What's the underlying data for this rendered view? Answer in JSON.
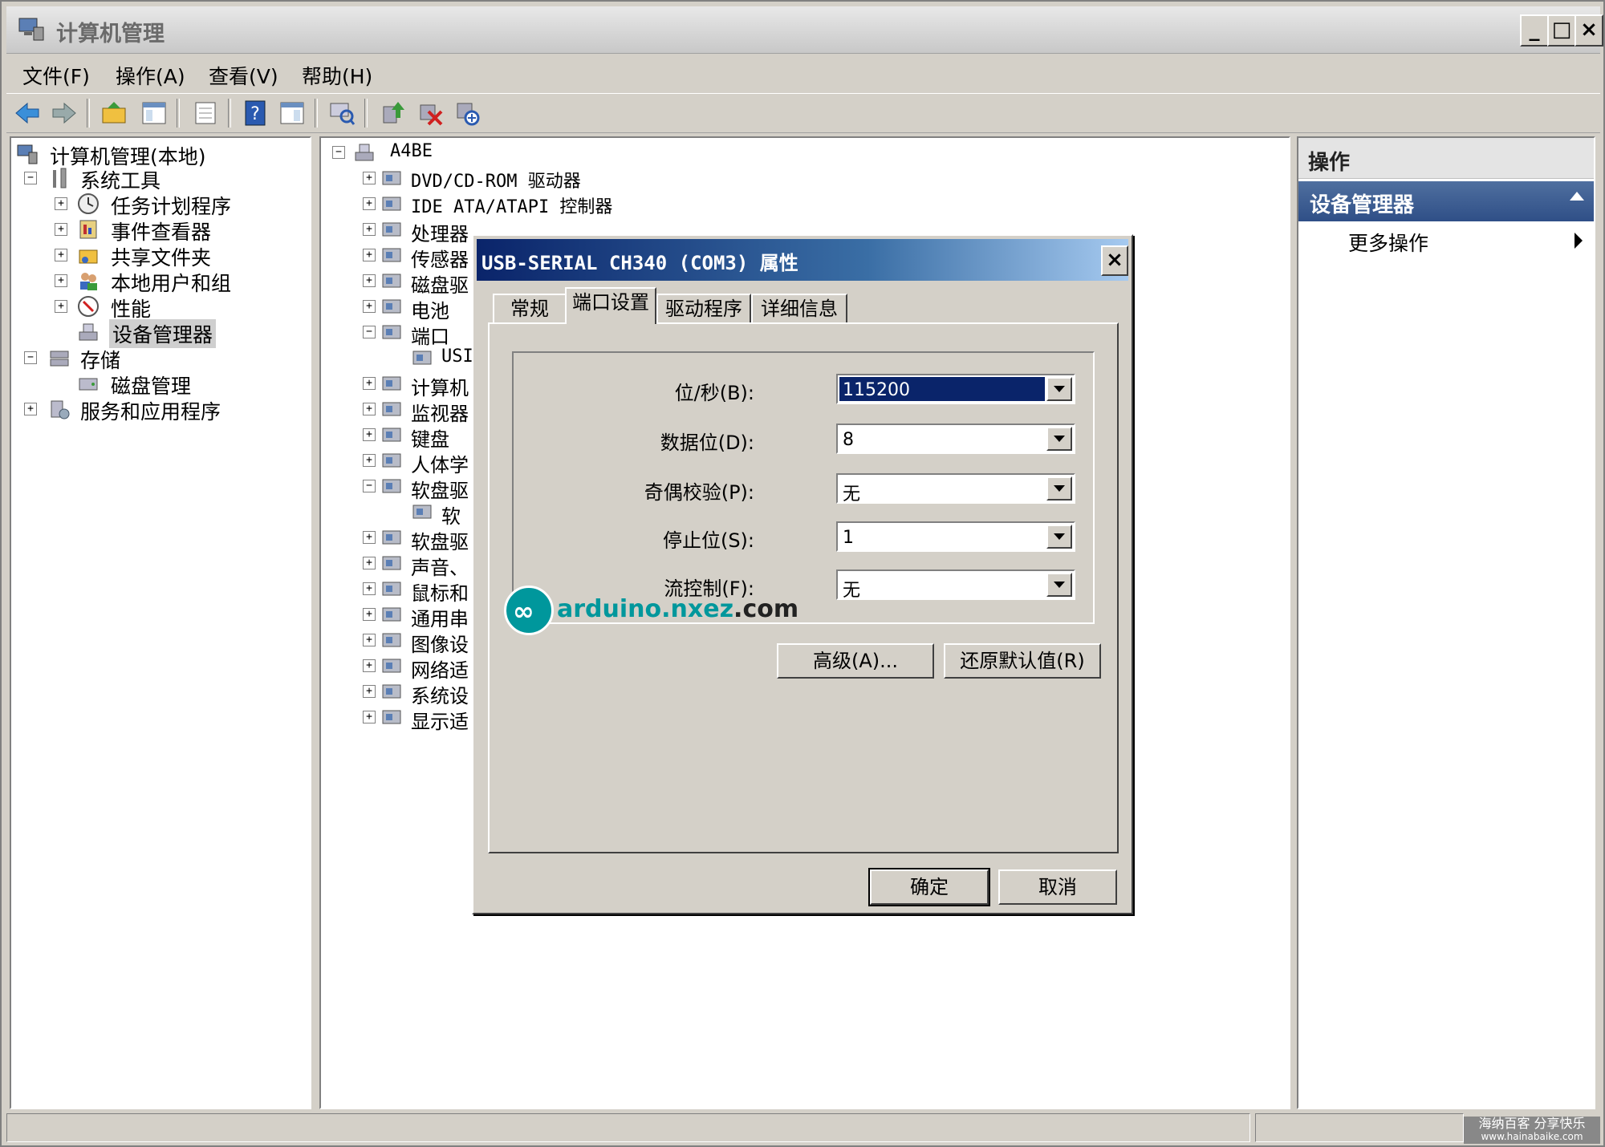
{
  "window": {
    "title": "计算机管理",
    "minimize": "_",
    "maximize": "□",
    "close": "×"
  },
  "menu": [
    "文件(F)",
    "操作(A)",
    "查看(V)",
    "帮助(H)"
  ],
  "left_tree": {
    "root": "计算机管理(本地)",
    "system_tools": "系统工具",
    "task_scheduler": "任务计划程序",
    "event_viewer": "事件查看器",
    "shared_folders": "共享文件夹",
    "local_users": "本地用户和组",
    "performance": "性能",
    "device_manager": "设备管理器",
    "storage": "存储",
    "disk_management": "磁盘管理",
    "services_apps": "服务和应用程序"
  },
  "device_tree": {
    "computer": "A4BE",
    "items": [
      "DVD/CD-ROM 驱动器",
      "IDE ATA/ATAPI 控制器",
      "处理器",
      "传感器",
      "磁盘驱",
      "电池",
      "端口",
      "USI",
      "计算机",
      "监视器",
      "键盘",
      "人体学",
      "软盘驱",
      "软",
      "软盘驱",
      "声音、",
      "鼠标和",
      "通用串",
      "图像设",
      "网络适",
      "系统设",
      "显示适"
    ]
  },
  "actions_pane": {
    "title": "操作",
    "section": "设备管理器",
    "more": "更多操作"
  },
  "dialog": {
    "title": "USB-SERIAL CH340 (COM3) 属性",
    "close": "×",
    "tabs": [
      "常规",
      "端口设置",
      "驱动程序",
      "详细信息"
    ],
    "active_tab": "端口设置",
    "fields": [
      {
        "label": "位/秒(B):",
        "value": "115200"
      },
      {
        "label": "数据位(D):",
        "value": "8"
      },
      {
        "label": "奇偶校验(P):",
        "value": "无"
      },
      {
        "label": "停止位(S):",
        "value": "1"
      },
      {
        "label": "流控制(F):",
        "value": "无"
      }
    ],
    "advanced": "高级(A)...",
    "restore": "还原默认值(R)",
    "ok": "确定",
    "cancel": "取消"
  },
  "watermark": {
    "logo_part1": "arduino",
    "logo_part2": ".nxez",
    "logo_part3": ".com",
    "corner_line1": "海纳百客 分享快乐",
    "corner_line2": "www.hainabaike.com"
  },
  "icons": [
    "computer-icon",
    "tools-icon",
    "clock-icon",
    "event-icon",
    "share-icon",
    "users-icon",
    "performance-icon",
    "device-manager-icon",
    "storage-icon",
    "disk-icon",
    "services-icon",
    "back-icon",
    "forward-icon",
    "up-icon",
    "help-icon",
    "uninstall-icon",
    "scan-icon",
    "update-icon"
  ],
  "colors": {
    "title_gradient_start": "#0a246a",
    "section_header": "#2f4f87",
    "logo_teal": "#00979c"
  }
}
